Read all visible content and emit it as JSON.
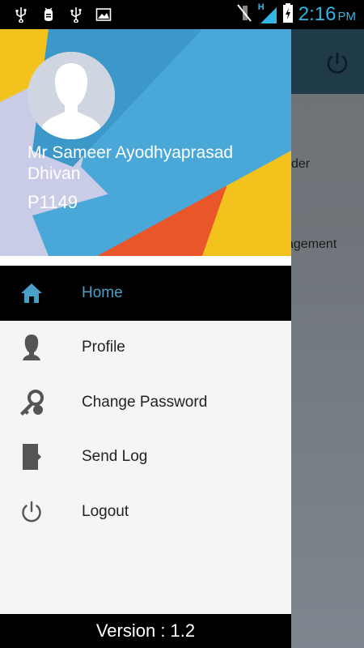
{
  "status_bar": {
    "time": "2:16",
    "ampm": "PM",
    "network_label": "H",
    "icons": [
      "usb-icon",
      "android-debug-icon",
      "usb-icon",
      "image-icon",
      "mute-icon",
      "signal-icon",
      "battery-charging-icon"
    ]
  },
  "background_app": {
    "item1_partial": "der",
    "item2_partial": "agement"
  },
  "drawer": {
    "user_name": "Mr Sameer Ayodhyaprasad Dhivan",
    "user_id": "P1149",
    "menu": [
      {
        "label": "Home",
        "icon": "home-icon",
        "active": true
      },
      {
        "label": "Profile",
        "icon": "profile-icon",
        "active": false
      },
      {
        "label": "Change Password",
        "icon": "key-icon",
        "active": false
      },
      {
        "label": "Send Log",
        "icon": "send-log-icon",
        "active": false
      },
      {
        "label": "Logout",
        "icon": "power-icon",
        "active": false
      }
    ],
    "version": "Version : 1.2"
  },
  "colors": {
    "accent": "#4a9fc9",
    "clock": "#33b5e5",
    "header_blue": "#4aa8d8",
    "header_yellow": "#f4c21d",
    "header_orange": "#e8562a",
    "header_lavender": "#c9cce6"
  }
}
